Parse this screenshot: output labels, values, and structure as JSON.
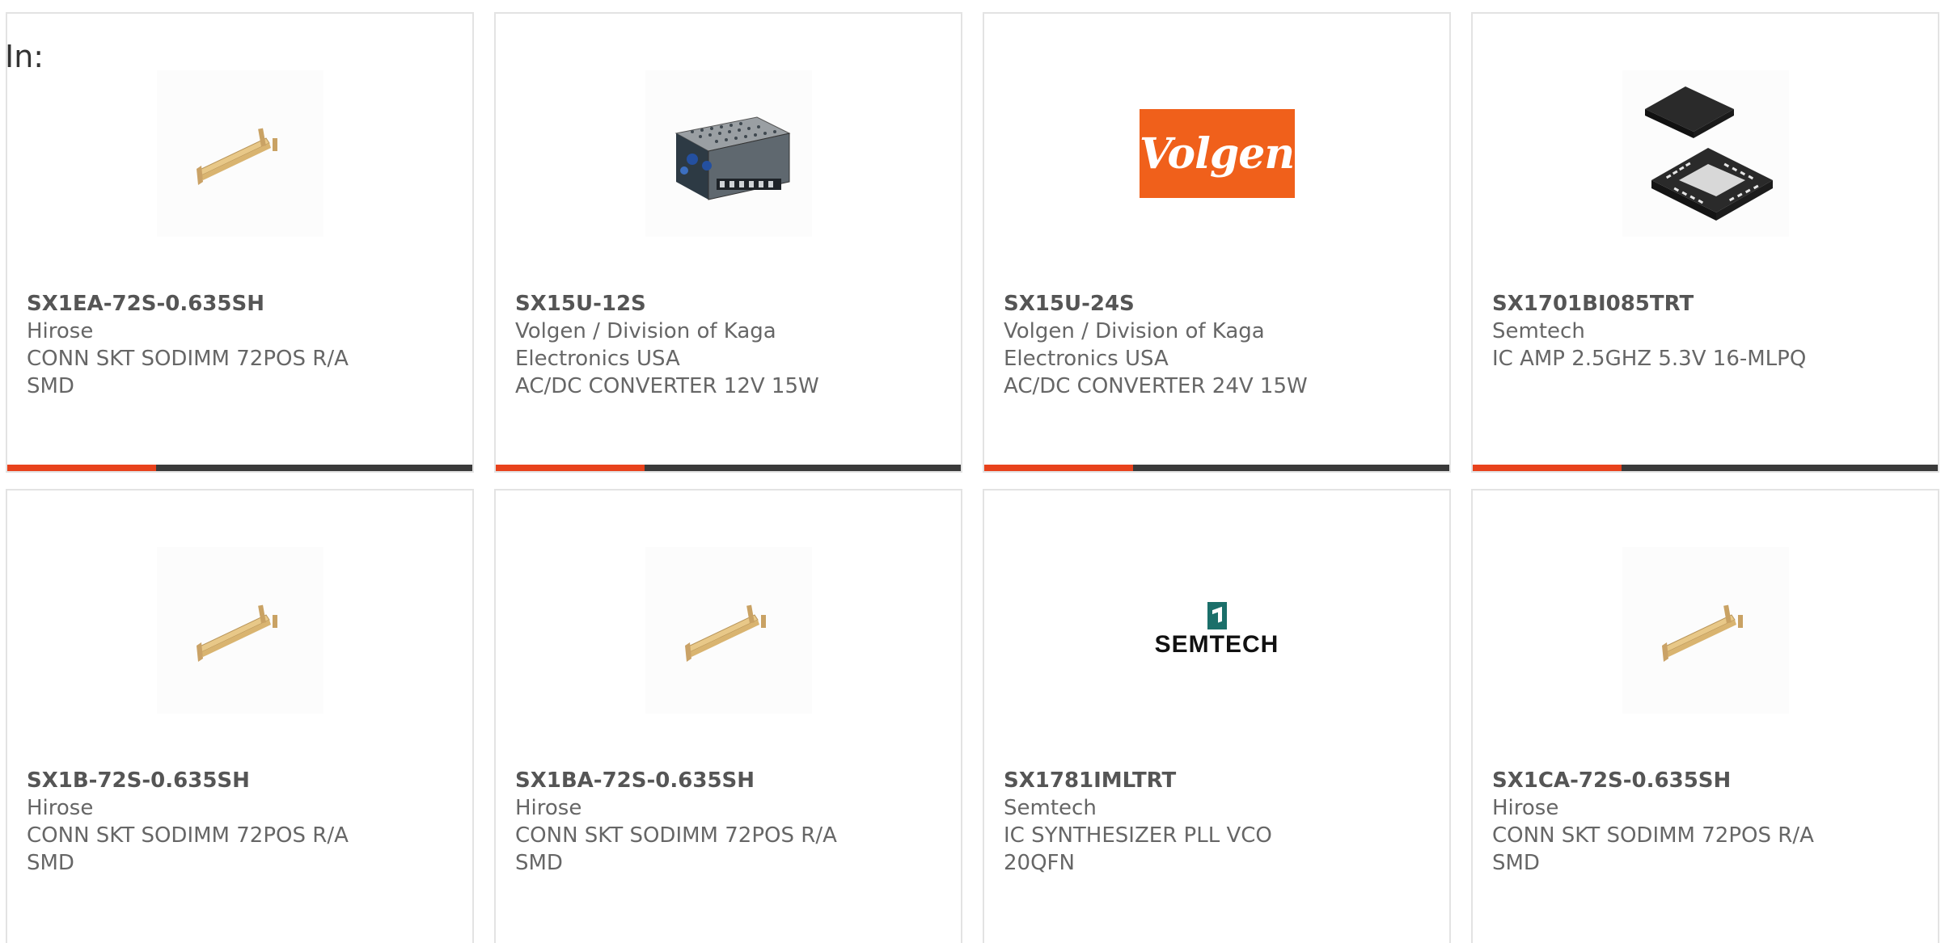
{
  "header": {
    "in_label": "In:"
  },
  "colors": {
    "accent": "#e8421c",
    "bar_track": "#3a3a3a",
    "card_border": "#e3e3e3",
    "text": "#666666"
  },
  "cards": [
    {
      "part_number": "SX1EA-72S-0.635SH",
      "manufacturer": "Hirose",
      "description": "CONN SKT SODIMM 72POS R/A SMD",
      "image": "connector-image",
      "progress": 0.32
    },
    {
      "part_number": "SX15U-12S",
      "manufacturer": "Volgen / Division of Kaga Electronics USA",
      "description": "AC/DC CONVERTER 12V 15W",
      "image": "power-supply-image",
      "progress": 0.32
    },
    {
      "part_number": "SX15U-24S",
      "manufacturer": "Volgen / Division of Kaga Electronics USA",
      "description": "AC/DC CONVERTER 24V 15W",
      "image": "volgen-logo",
      "logo_text": "Volgen",
      "progress": 0.32
    },
    {
      "part_number": "SX1701BI085TRT",
      "manufacturer": "Semtech",
      "description": "IC AMP 2.5GHZ 5.3V 16-MLPQ",
      "image": "ic-chip-image",
      "progress": 0.32
    },
    {
      "part_number": "SX1B-72S-0.635SH",
      "manufacturer": "Hirose",
      "description": "CONN SKT SODIMM 72POS R/A SMD",
      "image": "connector-image"
    },
    {
      "part_number": "SX1BA-72S-0.635SH",
      "manufacturer": "Hirose",
      "description": "CONN SKT SODIMM 72POS R/A SMD",
      "image": "connector-image"
    },
    {
      "part_number": "SX1781IMLTRT",
      "manufacturer": "Semtech",
      "description": "IC SYNTHESIZER PLL VCO 20QFN",
      "image": "semtech-logo",
      "logo_text": "SEMTECH"
    },
    {
      "part_number": "SX1CA-72S-0.635SH",
      "manufacturer": "Hirose",
      "description": "CONN SKT SODIMM 72POS R/A SMD",
      "image": "connector-image"
    }
  ]
}
